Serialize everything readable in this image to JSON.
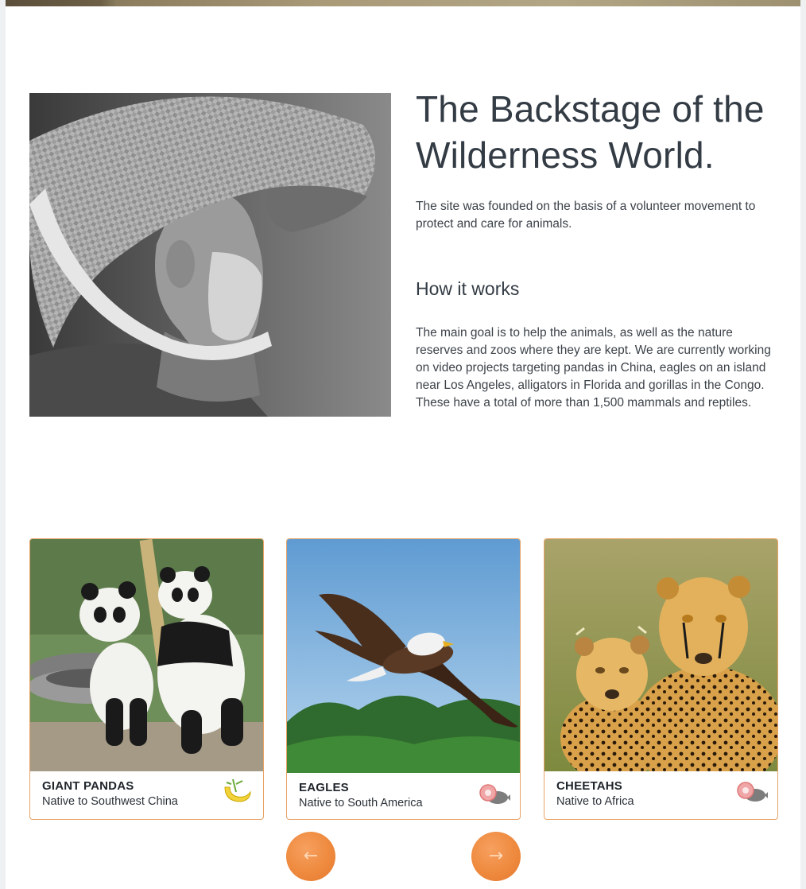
{
  "intro": {
    "title": "The Backstage of the Wilderness World.",
    "lead": "The site was founded on the basis of a volunteer movement to protect and care for animals.",
    "how_heading": "How it works",
    "how_body": "The main goal is to help the animals, as well as the nature reserves and zoos where they are kept. We are currently working on video projects targeting pandas in China, eagles on an island near Los Angeles, alligators in Florida and gorillas in the Congo. These have a total of more than 1,500 mammals and reptiles."
  },
  "cards": [
    {
      "name": "GIANT PANDAS",
      "origin": "Native to Southwest China",
      "diet_icon": "banana-bamboo-icon"
    },
    {
      "name": "EAGLES",
      "origin": "Native to South America",
      "diet_icon": "meat-fish-icon"
    },
    {
      "name": "CHEETAHS",
      "origin": "Native to Africa",
      "diet_icon": "meat-fish-icon"
    }
  ],
  "nav": {
    "prev_arrow": "←",
    "next_arrow": "→"
  },
  "colors": {
    "accent": "#ee8a3e",
    "card_border": "#e8a265",
    "text": "#333b44"
  }
}
